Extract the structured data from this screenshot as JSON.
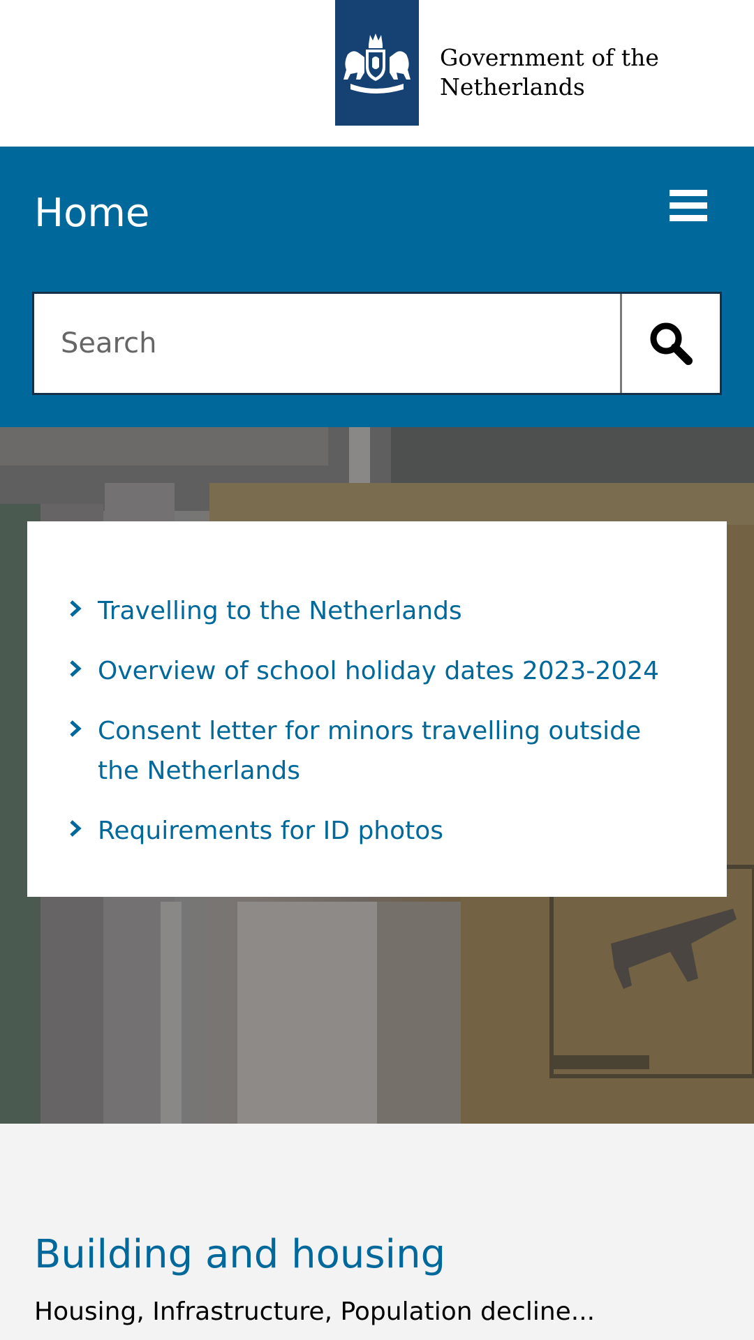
{
  "logo": {
    "line1": "Government of the",
    "line2": "Netherlands",
    "emblem_icon": "coat-of-arms-icon",
    "emblem_color": "#154273"
  },
  "header": {
    "title": "Home",
    "menu_icon": "hamburger-menu-icon",
    "background_color": "#01689b"
  },
  "search": {
    "placeholder": "Search",
    "value": "",
    "button_icon": "magnifier-icon"
  },
  "hero": {
    "links": [
      {
        "label": "Travelling to the Netherlands"
      },
      {
        "label": "Overview of school holiday dates 2023-2024"
      },
      {
        "label": "Consent letter for minors travelling outside the Netherlands"
      },
      {
        "label": "Requirements for ID photos"
      }
    ],
    "link_icon": "chevron-right-icon",
    "link_color": "#01689b"
  },
  "category": {
    "title": "Building and housing",
    "description": "Housing, Infrastructure, Population decline..."
  }
}
